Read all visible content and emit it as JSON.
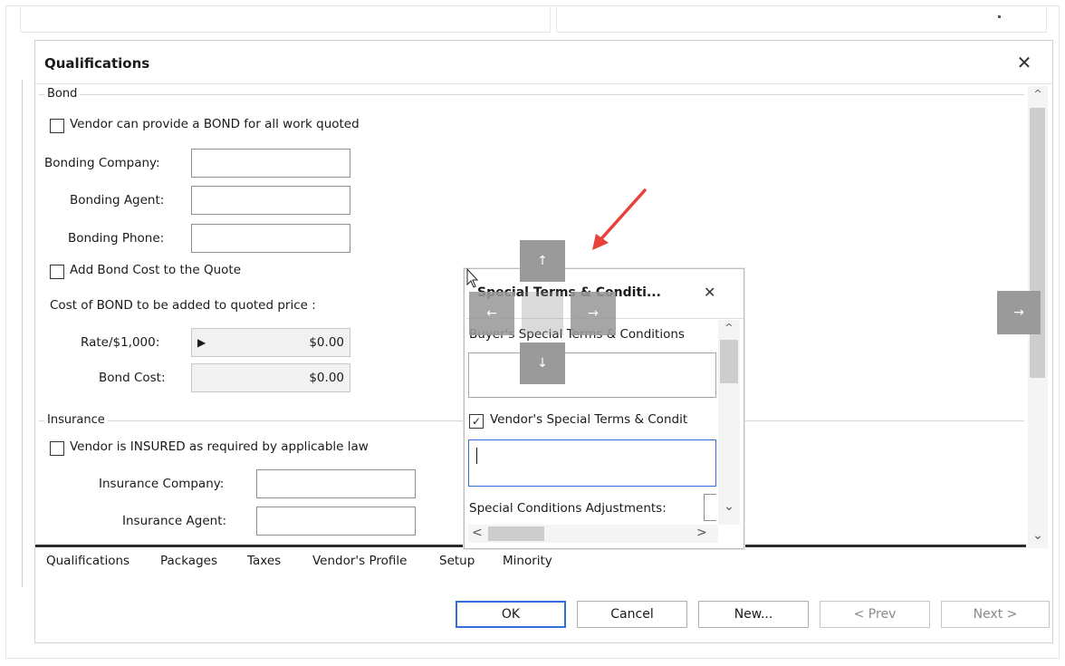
{
  "dialog": {
    "title": "Qualifications",
    "close_glyph": "✕"
  },
  "bond": {
    "group_title": "Bond",
    "provide_bond_label": "Vendor can provide a BOND for all work quoted",
    "bonding_company_label": "Bonding Company:",
    "bonding_agent_label": "Bonding Agent:",
    "bonding_phone_label": "Bonding Phone:",
    "add_cost_label": "Add Bond Cost to the Quote",
    "cost_heading": "Cost of BOND to be added to quoted price :",
    "rate_label": "Rate/$1,000:",
    "rate_value": "$0.00",
    "bond_cost_label": "Bond Cost:",
    "bond_cost_value": "$0.00"
  },
  "insurance": {
    "group_title": "Insurance",
    "insured_label": "Vendor is INSURED as required by applicable law",
    "company_label": "Insurance Company:",
    "agent_label": "Insurance Agent:"
  },
  "tabs": [
    {
      "label": "Qualifications"
    },
    {
      "label": "Packages"
    },
    {
      "label": "Taxes"
    },
    {
      "label": "Vendor's Profile"
    },
    {
      "label": "Setup"
    },
    {
      "label": "Minority"
    }
  ],
  "buttons": {
    "ok": "OK",
    "cancel": "Cancel",
    "new": "New...",
    "prev": "< Prev",
    "next": "Next >"
  },
  "floating_panel": {
    "title": "Special Terms & Conditi...",
    "close_glyph": "✕",
    "buyer_label": "Buyer's Special Terms & Conditions",
    "vendor_label": "Vendor's Special Terms & Condit",
    "adjustments_label": "Special Conditions Adjustments:"
  },
  "glyphs": {
    "up": "↑",
    "down": "↓",
    "left": "←",
    "right": "→",
    "scroll_up": "^",
    "scroll_down": "⌄",
    "scroll_left": "<",
    "scroll_right": ">",
    "row_pointer": "▶",
    "checkmark": "✓"
  },
  "colors": {
    "accent_blue": "#2e6fd9",
    "dock_gray": "#9a9a9a",
    "annotation_red": "#e8403a"
  }
}
